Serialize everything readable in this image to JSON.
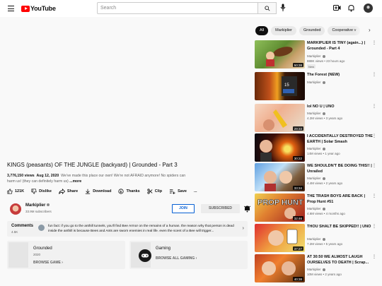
{
  "header": {
    "logo_text": "YouTube",
    "search_placeholder": "Search"
  },
  "video": {
    "title": "KINGS (peasants) OF THE JUNGLE (backyard) | Grounded - Part 3",
    "views": "3,776,150 views",
    "date": "Aug 12, 2020",
    "description": "We've made this place our own! We're not AFRAID anymore! No spiders can harm us! (they can definitely harm us)",
    "more_label": "...more",
    "actions": [
      {
        "label": "121K",
        "icon": "like-icon"
      },
      {
        "label": "Dislike",
        "icon": "dislike-icon"
      },
      {
        "label": "Share",
        "icon": "share-icon"
      },
      {
        "label": "Download",
        "icon": "download-icon"
      },
      {
        "label": "Thanks",
        "icon": "thanks-icon"
      },
      {
        "label": "Clip",
        "icon": "clip-icon"
      },
      {
        "label": "Save",
        "icon": "save-icon"
      }
    ],
    "more_actions": "..."
  },
  "channel": {
    "name": "Markiplier",
    "subscribers": "33.9M subscribers",
    "join_label": "JOIN",
    "subscribe_label": "SUBSCRIBED"
  },
  "comments": {
    "label": "Comments",
    "count": "4.5K",
    "top_comment": "fun fact: if you go to the anthill tunnels, you'll find Bee Armor on the remains of a human. the reason why that person is dead inside the anthill is because Bees and Ants are sworn enemies in real life. even the scent of a Bee will trigger..."
  },
  "cards": [
    {
      "title": "Grounded",
      "subtitle": "2020",
      "link": "BROWSE GAME"
    },
    {
      "title": "Gaming",
      "subtitle": "",
      "link": "BROWSE ALL GAMING"
    }
  ],
  "chips": [
    "All",
    "Markiplier",
    "Grounded",
    "Cooperative v"
  ],
  "recommendations": [
    {
      "title": "MARKIPLIER IS TINY (again...) | Grounded - Part 4",
      "channel": "Markiplier",
      "meta": "888K views • 23 hours ago",
      "badge": "New",
      "duration": "50:38"
    },
    {
      "title": "The Forest (NEW)",
      "channel": "Markiplier",
      "meta": "",
      "badge": "",
      "duration": ""
    },
    {
      "title": "lol NO U | UNO",
      "channel": "Markiplier",
      "meta": "4.2M views • 3 years ago",
      "badge": "",
      "duration": "29:33"
    },
    {
      "title": "I ACCIDENTALLY DESTROYED THE EARTH | Solar Smash",
      "channel": "Markiplier",
      "meta": "14M views • 1 year ago",
      "badge": "",
      "duration": "30:22"
    },
    {
      "title": "WE SHOULDN'T BE DOING THIS!! | Unrailed",
      "channel": "Markiplier",
      "meta": "4.4M views • 2 years ago",
      "badge": "",
      "duration": "33:34"
    },
    {
      "title": "THE TRASH BOYS ARE BACK | Prop Hunt #51",
      "channel": "Markiplier",
      "meta": "4.6M views • 4 months ago",
      "badge": "",
      "duration": "32:46"
    },
    {
      "title": "THOU SHALT BE SKIPPED!! | UNO",
      "channel": "Markiplier",
      "meta": "7.2M views • 5 years ago",
      "badge": "",
      "duration": "37:27"
    },
    {
      "title": "AT 30:50 WE ALMOST LAUGH OURSELVES TO DEATH | Scrap...",
      "channel": "Markiplier",
      "meta": "10M views • 2 years ago",
      "badge": "",
      "duration": "40:38"
    }
  ],
  "colors": {
    "brand": "#ff0000",
    "link_blue": "#065fd4"
  }
}
